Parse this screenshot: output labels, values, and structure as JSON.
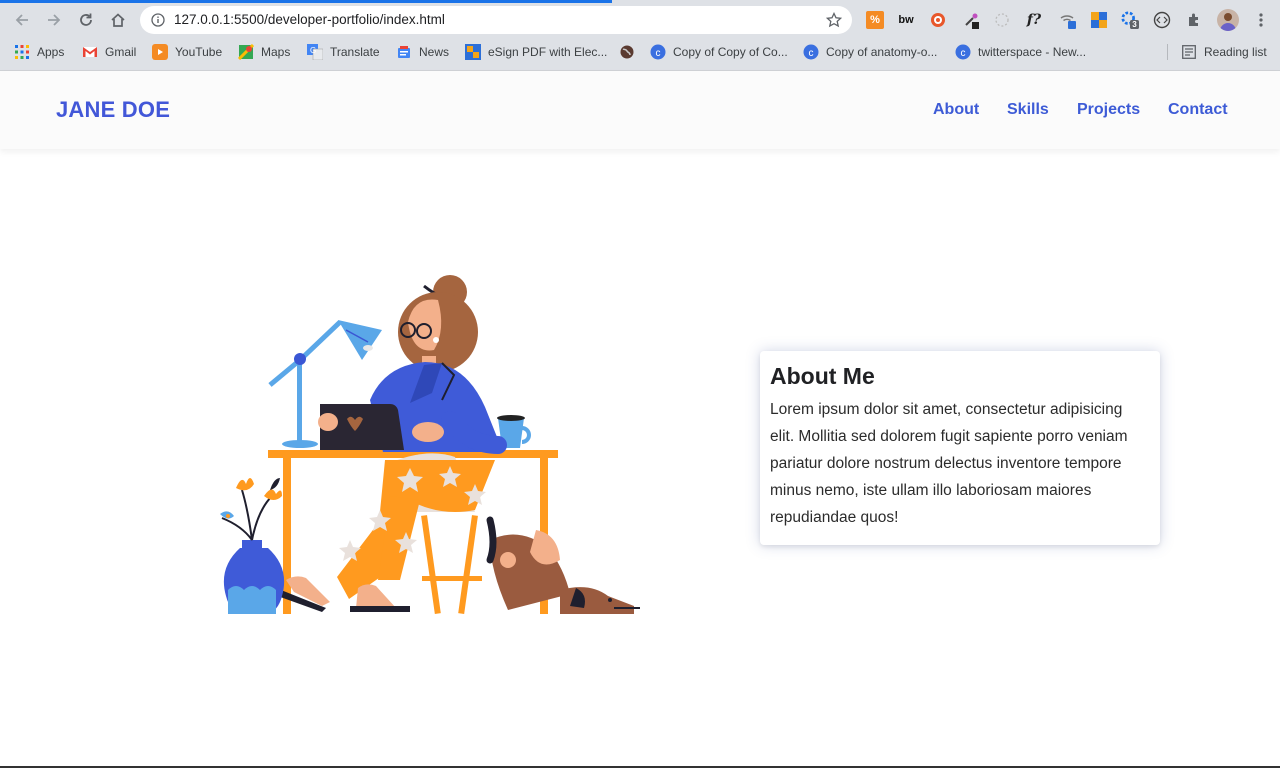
{
  "browser": {
    "url": "127.0.0.1:5500/developer-portfolio/index.html",
    "bookmarks": [
      {
        "label": "Apps",
        "icon": "apps-grid-icon"
      },
      {
        "label": "Gmail",
        "icon": "gmail-icon"
      },
      {
        "label": "YouTube",
        "icon": "youtube-icon"
      },
      {
        "label": "Maps",
        "icon": "maps-icon"
      },
      {
        "label": "Translate",
        "icon": "translate-icon"
      },
      {
        "label": "News",
        "icon": "news-icon"
      },
      {
        "label": "eSign PDF with Elec...",
        "icon": "esign-icon"
      },
      {
        "label": "",
        "icon": "globe-icon"
      },
      {
        "label": "Copy of Copy of Co...",
        "icon": "c-icon"
      },
      {
        "label": "Copy of anatomy-o...",
        "icon": "c-icon"
      },
      {
        "label": "twitterspace - New...",
        "icon": "c-icon"
      }
    ],
    "reading_list": "Reading list",
    "extension_badge": "3",
    "ext_text_bw": "bw",
    "ext_text_f": "f?",
    "colors": {
      "accent": "#1a73e8",
      "chrome_bg": "#dee1e6"
    }
  },
  "site": {
    "brand": "JANE DOE",
    "nav": [
      {
        "label": "About"
      },
      {
        "label": "Skills"
      },
      {
        "label": "Projects"
      },
      {
        "label": "Contact"
      }
    ],
    "about": {
      "title": "About Me",
      "text": "Lorem ipsum dolor sit amet, consectetur adipisicing elit. Mollitia sed dolorem fugit sapiente porro veniam pariatur dolore nostrum delectus inventore tempore minus nemo, iste ullam illo laboriosam maiores repudiandae quos!"
    },
    "colors": {
      "brand": "#4257d8",
      "nav": "#3d5bd6"
    }
  }
}
